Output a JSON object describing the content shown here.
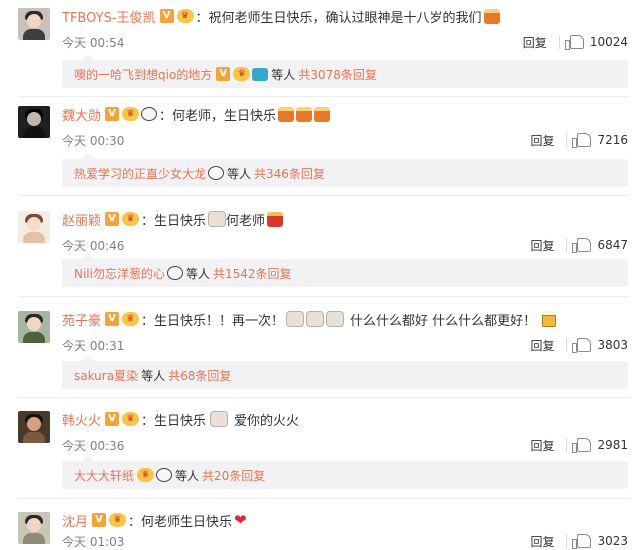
{
  "comments": [
    {
      "username": "TFBOYS-王俊凯",
      "content": "祝何老师生日快乐，确认过眼神是十八岁的我们",
      "time": "今天 00:54",
      "reply_label": "回复",
      "likes": "10024",
      "subreply": {
        "user": "噢的一哈飞到想qio的地方",
        "mid": "等人",
        "count": "共3078条回复"
      }
    },
    {
      "username": "魏大勋",
      "content": "何老师，生日快乐",
      "time": "今天 00:30",
      "reply_label": "回复",
      "likes": "7216",
      "subreply": {
        "user": "热爱学习的正直少女大龙",
        "mid": "等人",
        "count": "共346条回复"
      }
    },
    {
      "username": "赵丽颖",
      "content_a": "生日快乐",
      "content_b": "何老师",
      "time": "今天 00:46",
      "reply_label": "回复",
      "likes": "6847",
      "subreply": {
        "user": "Nili勿忘洋葱的心",
        "mid": "等人",
        "count": "共1542条回复"
      }
    },
    {
      "username": "苑子豪",
      "content_a": "生日快乐！！再一次！",
      "content_b": "什么什么都好 什么什么都更好！",
      "time": "今天 00:31",
      "reply_label": "回复",
      "likes": "3803",
      "subreply": {
        "user": "sakura夏染",
        "mid": "等人",
        "count": "共68条回复"
      }
    },
    {
      "username": "韩火火",
      "content_a": "生日快乐",
      "content_b": "爱你的火火",
      "time": "今天 00:36",
      "reply_label": "回复",
      "likes": "2981",
      "subreply": {
        "user": "大大大轩纸",
        "mid": "等人",
        "count": "共20条回复"
      }
    },
    {
      "username": "沈月",
      "content": "何老师生日快乐",
      "time": "今天 01:03",
      "reply_label": "回复",
      "likes": "3023"
    }
  ],
  "icons": {
    "verified": "V",
    "vip": "vip-crown",
    "like": "thumb-up"
  },
  "colors": {
    "username": "#eb7350",
    "subreply_bg": "#f2f2f5",
    "timestamp": "#808080"
  }
}
